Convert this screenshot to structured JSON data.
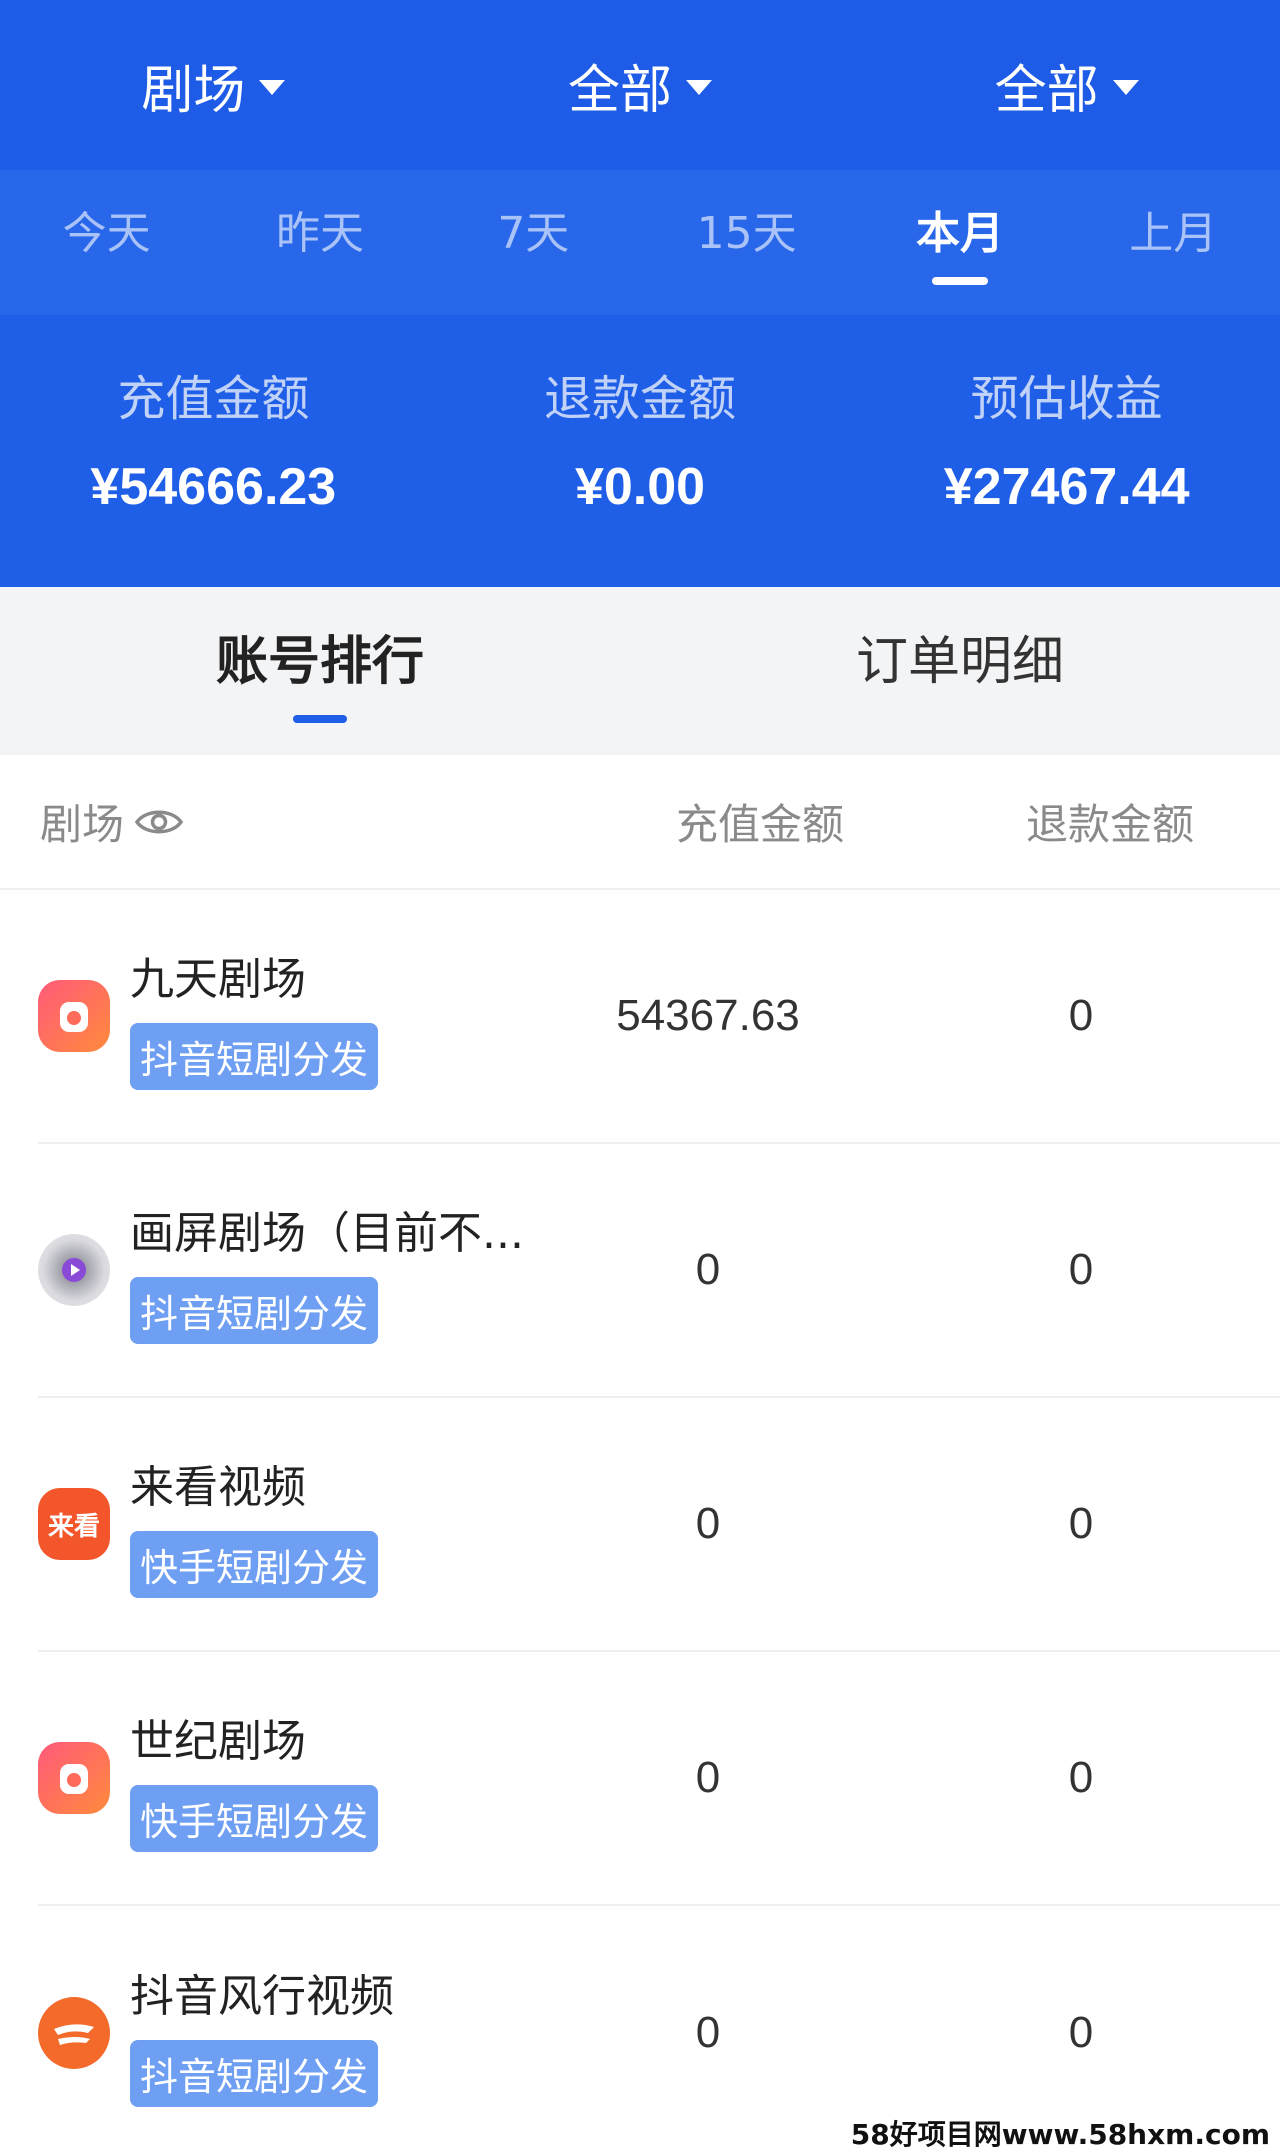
{
  "header": {
    "dropdowns": [
      "剧场",
      "全部",
      "全部"
    ]
  },
  "periods": [
    "今天",
    "昨天",
    "7天",
    "15天",
    "本月",
    "上月"
  ],
  "active_period": "本月",
  "stats": [
    {
      "label": "充值金额",
      "value": "¥54666.23"
    },
    {
      "label": "退款金额",
      "value": "¥0.00"
    },
    {
      "label": "预估收益",
      "value": "¥27467.44"
    }
  ],
  "tabs": [
    "账号排行",
    "订单明细"
  ],
  "table": {
    "columns": [
      "剧场",
      "充值金额",
      "退款金额"
    ],
    "rows": [
      {
        "logo": "九天剧场-logo",
        "logo_text": "",
        "name": "九天剧场",
        "badge": "抖音短剧分发",
        "recharge": "54367.63",
        "refund": "0"
      },
      {
        "logo": "画屏剧场-logo",
        "logo_text": "",
        "name": "画屏剧场（目前不...",
        "badge": "抖音短剧分发",
        "recharge": "0",
        "refund": "0"
      },
      {
        "logo": "来看视频-logo",
        "logo_text": "来看",
        "name": "来看视频",
        "badge": "快手短剧分发",
        "recharge": "0",
        "refund": "0"
      },
      {
        "logo": "世纪剧场-logo",
        "logo_text": "",
        "name": "世纪剧场",
        "badge": "快手短剧分发",
        "recharge": "0",
        "refund": "0"
      },
      {
        "logo": "抖音风行视频-logo",
        "logo_text": "",
        "name": "抖音风行视频",
        "badge": "抖音短剧分发",
        "recharge": "0",
        "refund": "0"
      }
    ]
  },
  "watermark": "58好项目网www.58hxm.com",
  "colors": {
    "primary": "#1f5ee6",
    "badge": "#6e9ff2"
  }
}
